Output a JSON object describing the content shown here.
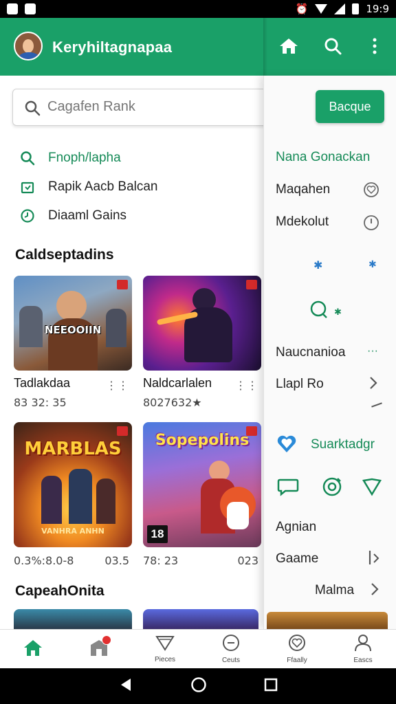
{
  "status_bar": {
    "time": "19:9"
  },
  "app_bar": {
    "title": "Keryhiltagnapaa",
    "icons": [
      "home-icon",
      "search-icon",
      "more-vert-icon"
    ],
    "accent": "#1aa068"
  },
  "search": {
    "placeholder": "Cagafen Rank"
  },
  "quick_links": [
    {
      "icon": "search-icon",
      "label": "Fnoph/lapha",
      "color": "#158a57"
    },
    {
      "icon": "bag-icon",
      "label": "Rapik Aacb Balcan",
      "color": "#222222"
    },
    {
      "icon": "clock-icon",
      "label": "Diaaml Gains",
      "color": "#222222"
    }
  ],
  "section1": {
    "title": "Caldseptadins",
    "cards": [
      {
        "name": "Tadlakdaa",
        "sub": "83 32: 35",
        "thumb_text": "NEEOOIIN"
      },
      {
        "name": "Naldcarlalen",
        "sub": "8027632★",
        "thumb_text": ""
      },
      {
        "name": "",
        "sub": "0.3%:8.0-8",
        "right": "03.5",
        "thumb_text": "MARBLAS",
        "thumb_sub": "VANHRA ANHN"
      },
      {
        "name": "",
        "sub": "78: 23",
        "right": "023",
        "thumb_text": "Sopepolins",
        "age": "18"
      }
    ]
  },
  "section2": {
    "title": "CapeahOnita"
  },
  "panel": {
    "button_label": "Bacque",
    "heading": "Nana Gonackan",
    "items": [
      {
        "label": "Maqahen"
      },
      {
        "label": "Mdekolut"
      },
      {
        "label": "Naucnanioa"
      },
      {
        "label": "Llapl Ro"
      }
    ],
    "featured": "Suarktadgr",
    "agnian": "Agnian",
    "gaame": "Gaame",
    "maima": "Malma"
  },
  "bottom_nav": [
    {
      "icon": "home-icon",
      "label": ""
    },
    {
      "icon": "store-icon",
      "label": "",
      "badge": true
    },
    {
      "icon": "pizza-icon",
      "label": "Pieces"
    },
    {
      "icon": "clock-icon",
      "label": "Ceuts"
    },
    {
      "icon": "heart-icon",
      "label": "Ffaally"
    },
    {
      "icon": "person-icon",
      "label": "Eascs"
    }
  ]
}
